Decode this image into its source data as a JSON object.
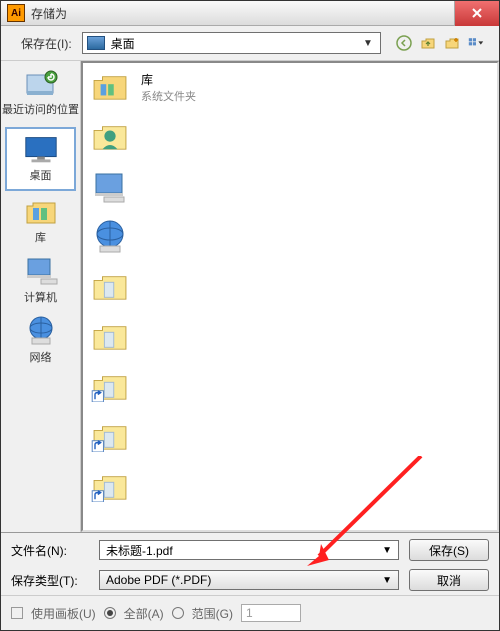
{
  "title": "存储为",
  "close": "×",
  "lookIn": {
    "label": "保存在(I):",
    "value": "桌面"
  },
  "sidebar": [
    {
      "label": "最近访问的位置"
    },
    {
      "label": "桌面"
    },
    {
      "label": "库"
    },
    {
      "label": "计算机"
    },
    {
      "label": "网络"
    }
  ],
  "items": [
    {
      "name": "库",
      "sub": "系统文件夹"
    }
  ],
  "filename": {
    "label": "文件名(N):",
    "value": "未标题-1.pdf"
  },
  "filetype": {
    "label": "保存类型(T):",
    "value": "Adobe PDF (*.PDF)"
  },
  "buttons": {
    "save": "保存(S)",
    "cancel": "取消"
  },
  "options": {
    "artboards": "使用画板(U)",
    "all": "全部(A)",
    "range": "范围(G)",
    "rangeVal": "1"
  },
  "aiIcon": "Ai"
}
